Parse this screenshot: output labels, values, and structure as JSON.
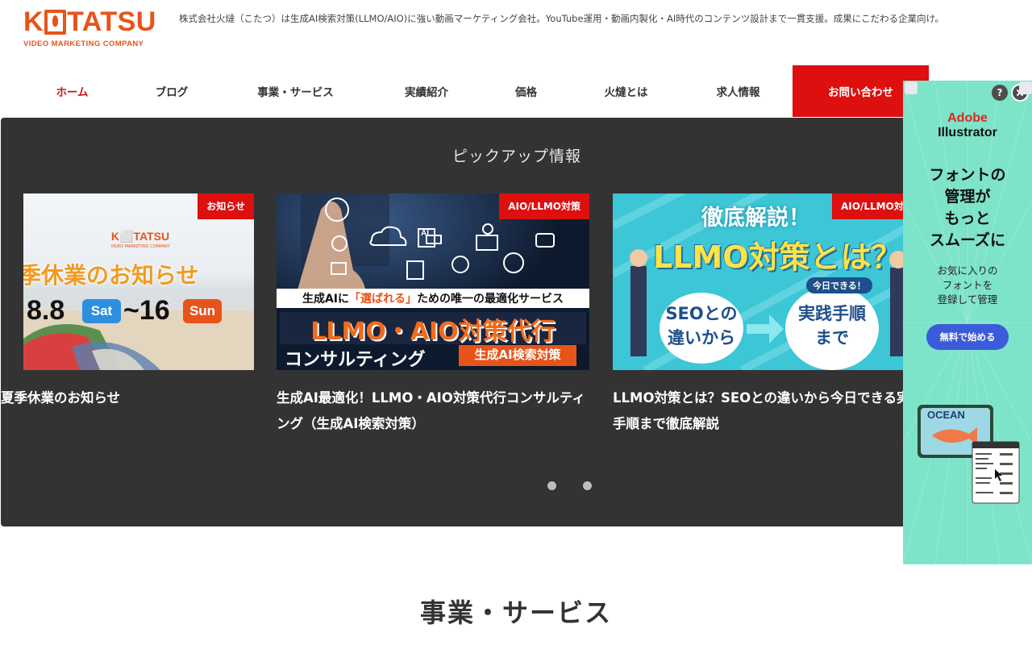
{
  "header": {
    "logo_text_k": "K",
    "logo_text_rest": "TATSU",
    "logo_subtitle": "VIDEO MARKETING COMPANY",
    "tagline": "株式会社火燵（こたつ）は生成AI検索対策(LLMO/AIO)に強い動画マーケティング会社。YouTube運用・動画内製化・AI時代のコンテンツ設計まで一貫支援。成果にこだわる企業向け。"
  },
  "nav": {
    "items": [
      {
        "label": "ホーム"
      },
      {
        "label": "ブログ"
      },
      {
        "label": "事業・サービス"
      },
      {
        "label": "実績紹介"
      },
      {
        "label": "価格"
      },
      {
        "label": "火燵とは"
      },
      {
        "label": "求人情報"
      },
      {
        "label": "お問い合わせ"
      }
    ]
  },
  "pickup": {
    "title": "ピックアップ情報",
    "cards": [
      {
        "badge": "お知らせ",
        "title": "夏季休業のお知らせ",
        "image": {
          "logo": "K⬜TATSU",
          "logo_sub": "VIDEO MARKETING COMPANY",
          "headline": "夏季休業のお知らせ",
          "date_start": "8.8",
          "day_start": "Sat",
          "date_end": "~16",
          "day_end": "Sun"
        }
      },
      {
        "badge": "AIO/LLMO対策",
        "title": "生成AI最適化！LLMO・AIO対策代行コンサルティング（生成AI検索対策）",
        "image": {
          "line1_pre": "生成AIに",
          "line1_em": "「選ばれる」",
          "line1_post": "ための唯一の最適化サービス",
          "line2": "LLMO・AIO対策代行",
          "line3": "コンサルティング",
          "line3_tag": "生成AI検索対策",
          "ai_label": "AI"
        }
      },
      {
        "badge": "AIO/LLMO対策",
        "title": "LLMO対策とは？SEOとの違いから今日できる実践手順まで徹底解説",
        "image": {
          "top": "徹底解説！",
          "main": "LLMO対策とは？",
          "bubble_left_1": "SEOとの",
          "bubble_left_2": "違いから",
          "bubble_tag": "今日できる！",
          "bubble_right_1": "実践手順",
          "bubble_right_2": "まで"
        }
      }
    ],
    "carousel_dots": 2
  },
  "section": {
    "title": "事業・サービス"
  },
  "ad": {
    "help": "?",
    "brand_line1": "Adobe",
    "brand_line2": "Illustrator",
    "headline": [
      "フォントの",
      "管理が",
      "もっと",
      "スムーズに"
    ],
    "sub": [
      "お気に入りの",
      "フォントを",
      "登録して管理"
    ],
    "button": "無料で始める",
    "illus_label": "OCEAN"
  },
  "colors": {
    "brand": "#e8531a",
    "accent_red": "#dd0f0f",
    "pickup_bg": "#333333",
    "ad_bg": "#7de3c9",
    "ad_button": "#3b5bdb"
  }
}
